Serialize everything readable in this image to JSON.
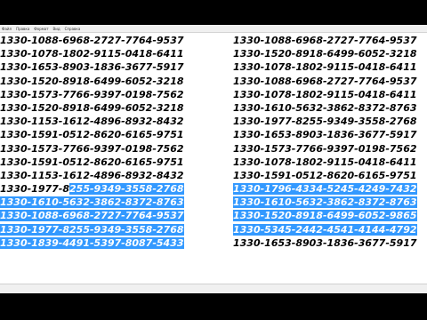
{
  "menu": [
    "Файл",
    "Правка",
    "Формат",
    "Вид",
    "Справка"
  ],
  "left_column": [
    {
      "text": "1330-1088-6968-2727-7764-9537"
    },
    {
      "text": "1330-1078-1802-9115-0418-6411"
    },
    {
      "text": "1330-1653-8903-1836-3677-5917"
    },
    {
      "text": "1330-1520-8918-6499-6052-3218"
    },
    {
      "text": "1330-1573-7766-9397-0198-7562"
    },
    {
      "text": "1330-1520-8918-6499-6052-3218"
    },
    {
      "text": "1330-1153-1612-4896-8932-8432"
    },
    {
      "text": "1330-1591-0512-8620-6165-9751"
    },
    {
      "text": "1330-1573-7766-9397-0198-7562"
    },
    {
      "text": "1330-1591-0512-8620-6165-9751"
    },
    {
      "text": "1330-1153-1612-4896-8932-8432"
    },
    {
      "text": "1330-1977-8",
      "selected_text": "255-9349-3558-2768"
    },
    {
      "selected_text": "1330-1610-5632-3862-8372-8763"
    },
    {
      "selected_text": "1330-1088-6968-2727-7764-9537"
    },
    {
      "selected_text": "1330-1977-8255-9349-3558-2768"
    },
    {
      "selected_text": "1330-1839-4491-5397-8087-5433"
    }
  ],
  "right_column": [
    {
      "text": "1330-1088-6968-2727-7764-9537"
    },
    {
      "text": "1330-1520-8918-6499-6052-3218"
    },
    {
      "text": "1330-1078-1802-9115-0418-6411"
    },
    {
      "text": "1330-1088-6968-2727-7764-9537"
    },
    {
      "text": "1330-1078-1802-9115-0418-6411"
    },
    {
      "text": "1330-1610-5632-3862-8372-8763"
    },
    {
      "text": "1330-1977-8255-9349-3558-2768"
    },
    {
      "text": "1330-1653-8903-1836-3677-5917"
    },
    {
      "text": "1330-1573-7766-9397-0198-7562"
    },
    {
      "text": "1330-1078-1802-9115-0418-6411"
    },
    {
      "text": "1330-1591-0512-8620-6165-9751"
    },
    {
      "selected_text": "1330-1796-4334-5245-4249-7432"
    },
    {
      "selected_text": "1330-1610-5632-3862-8372-8763"
    },
    {
      "selected_text": "1330-1520-8918-6499-6052-9865"
    },
    {
      "selected_text": "1330-5345-2442-4541-4144-4792"
    },
    {
      "text": "1330-1653-8903-1836-3677-5917"
    }
  ]
}
